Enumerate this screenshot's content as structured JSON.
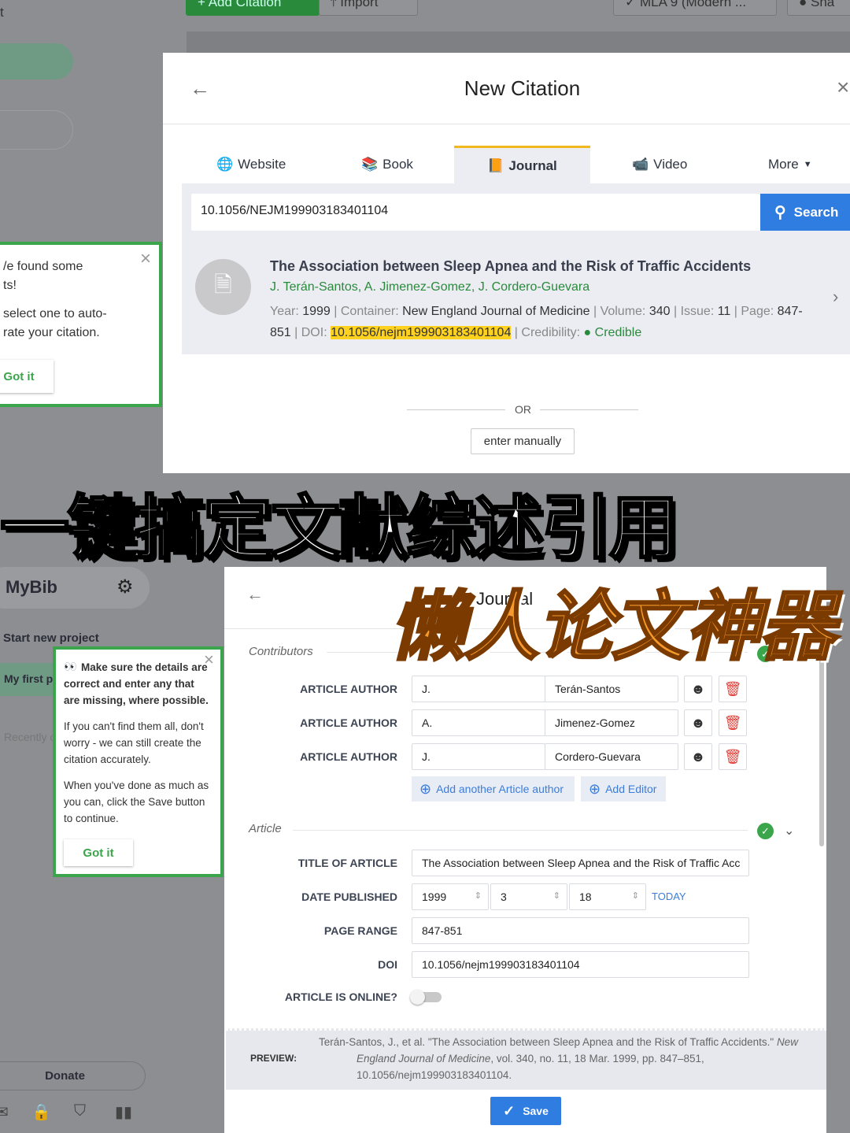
{
  "background_app": {
    "sidebar_partial_text": "t",
    "add_citation": "Add Citation",
    "import": "Import",
    "style": "MLA 9 (Modern ...",
    "share": "Sha",
    "brand": "MyBib",
    "start_new_project": "Start new project",
    "project": "My first pr",
    "recently": "Recently c",
    "donate": "Donate"
  },
  "new_citation": {
    "title": "New Citation",
    "tabs": [
      {
        "label": "Website",
        "icon": "globe-icon"
      },
      {
        "label": "Book",
        "icon": "books-icon"
      },
      {
        "label": "Journal",
        "icon": "journal-icon",
        "active": true
      },
      {
        "label": "Video",
        "icon": "camera-icon"
      },
      {
        "label": "More",
        "icon": "caret-down-icon"
      }
    ],
    "search_value": "10.1056/NEJM199903183401104",
    "search_button": "Search",
    "result": {
      "title": "The Association between Sleep Apnea and the Risk of Traffic Accidents",
      "authors": "J. Terán-Santos, A. Jimenez-Gomez, J. Cordero-Guevara",
      "year_label": "Year:",
      "year": "1999",
      "container_label": "Container:",
      "container": "New England Journal of Medicine",
      "volume_label": "Volume:",
      "volume": "340",
      "issue_label": "Issue:",
      "issue": "11",
      "page_label": "Page:",
      "page": "847-851",
      "doi_label": "DOI:",
      "doi": "10.1056/nejm199903183401104",
      "credibility_label": "Credibility:",
      "credibility": "Credible"
    },
    "or": "OR",
    "enter_manually": "enter manually"
  },
  "tip1": {
    "line1": "We found some",
    "line2": "results!",
    "body": "select one to auto-generate your citation.",
    "body_l1": "select one to auto-",
    "body_l2": "rate your citation.",
    "line1_partial": "/e found some",
    "line2_partial": "ts!",
    "got_it": "Got it"
  },
  "overlay": {
    "headline": "一键搞定文献综述引用",
    "subheadline": "懒人论文神器"
  },
  "journal_form": {
    "title": "Journal",
    "contributors_heading": "Contributors",
    "authors": [
      {
        "label": "ARTICLE AUTHOR",
        "first": "J.",
        "last": "Terán-Santos"
      },
      {
        "label": "ARTICLE AUTHOR",
        "first": "A.",
        "last": "Jimenez-Gomez"
      },
      {
        "label": "ARTICLE AUTHOR",
        "first": "J.",
        "last": "Cordero-Guevara"
      }
    ],
    "add_author": "Add another Article author",
    "add_editor": "Add Editor",
    "article_heading": "Article",
    "title_label": "TITLE OF ARTICLE",
    "title_value": "The Association between Sleep Apnea and the Risk of Traffic Acc",
    "date_label": "DATE PUBLISHED",
    "year": "1999",
    "month": "3",
    "day": "18",
    "today": "TODAY",
    "page_label": "PAGE RANGE",
    "page_value": "847-851",
    "doi_label": "DOI",
    "doi_value": "10.1056/nejm199903183401104",
    "online_label": "ARTICLE IS ONLINE?",
    "online": false,
    "preview_label": "PREVIEW:",
    "preview_l1": "Terán-Santos, J., et al. \"The Association between Sleep Apnea and the Risk of Traffic Accidents.\"",
    "preview_new": "New",
    "preview_journal": "England Journal of Medicine",
    "preview_l2": ", vol. 340, no. 11, 18 Mar. 1999, pp. 847–851,",
    "preview_l3": "10.1056/nejm199903183401104.",
    "save": "Save"
  },
  "tip2": {
    "p1": "Make sure the details are correct and enter any that are missing, where possible.",
    "p2": "If you can't find them all, don't worry - we can still create the citation accurately.",
    "p3": "When you've done as much as you can, click the Save button to continue.",
    "got_it": "Got it"
  },
  "colors": {
    "accent": "#2f7de1",
    "green": "#3aa54a",
    "tab_active": "#f2b91f",
    "highlight": "#ffd21f",
    "headline_orange": "#f59a2c"
  }
}
